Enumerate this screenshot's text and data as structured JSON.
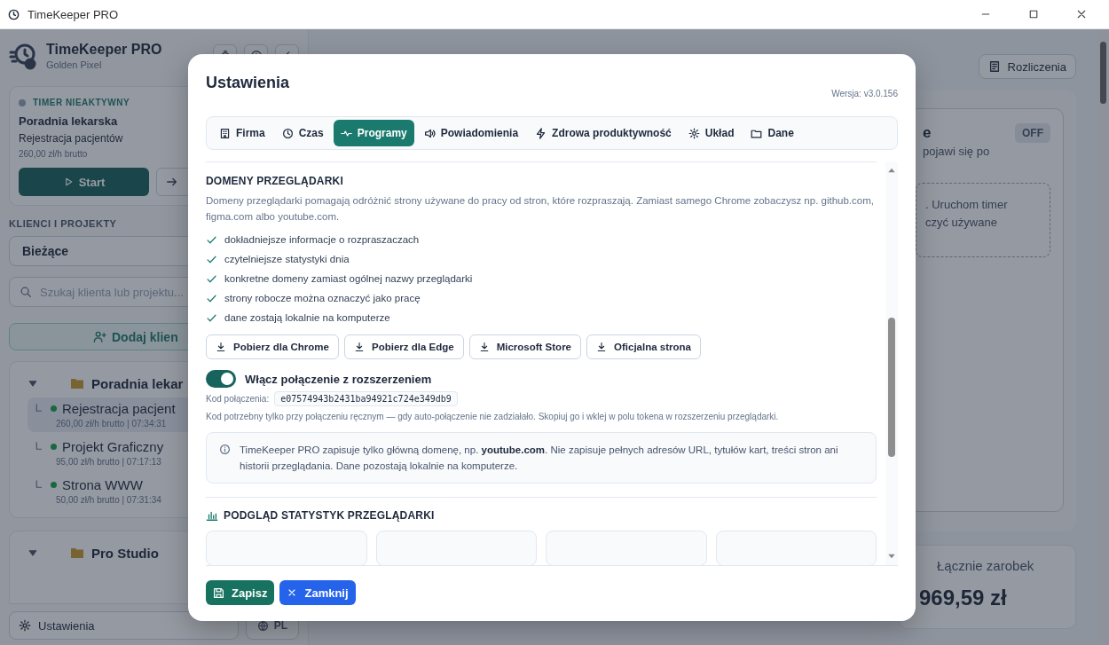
{
  "window": {
    "title": "TimeKeeper PRO"
  },
  "sidebar": {
    "app_name": "TimeKeeper PRO",
    "workspace": "Golden Pixel",
    "timer": {
      "status": "TIMER NIEAKTYWNY",
      "active": false,
      "client": "Poradnia lekarska",
      "project": "Rejestracja pacjentów",
      "rate": "260,00 zł/h brutto",
      "start_button": "Start"
    },
    "section_title": "KLIENCI I PROJEKTY",
    "filter": "Bieżące",
    "search": {
      "placeholder": "Szukaj klienta lub projektu..."
    },
    "add_button": "Dodaj klien",
    "clients": [
      {
        "name": "Poradnia lekar",
        "expanded": true,
        "projects": [
          {
            "name": "Rejestracja pacjent",
            "detail": "260,00 zł/h brutto | 07:34:31",
            "selected": true
          },
          {
            "name": "Projekt Graficzny",
            "detail": "95,00 zł/h brutto | 07:17:13",
            "selected": false
          },
          {
            "name": "Strona WWW",
            "detail": "50,00 zł/h brutto | 07:31:34",
            "selected": false
          }
        ]
      },
      {
        "name": "Pro Studio",
        "expanded": true
      }
    ],
    "settings_button": "Ustawienia",
    "language_button": "PL"
  },
  "main": {
    "billing_button": "Rozliczenia",
    "card": {
      "title": "e",
      "badge": "OFF",
      "subtitle": "pojawi się po",
      "empty_state": [
        ". Uruchom timer",
        "czyć używane"
      ]
    },
    "total": {
      "label": "Łącznie zarobek",
      "value": "969,59 zł"
    }
  },
  "modal": {
    "title": "Ustawienia",
    "version": "Wersja: v3.0.156",
    "tabs": [
      {
        "label": "Firma",
        "selected": false
      },
      {
        "label": "Czas",
        "selected": false
      },
      {
        "label": "Programy",
        "selected": true
      },
      {
        "label": "Powiadomienia",
        "selected": false
      },
      {
        "label": "Zdrowa produktywność",
        "selected": false
      },
      {
        "label": "Układ",
        "selected": false
      },
      {
        "label": "Dane",
        "selected": false
      }
    ],
    "section_title": "DOMENY PRZEGLĄDARKI",
    "description": "Domeny przeglądarki pomagają odróżnić strony używane do pracy od stron, które rozpraszają. Zamiast samego Chrome zobaczysz np. github.com, figma.com albo youtube.com.",
    "features": [
      "dokładniejsze informacje o rozpraszaczach",
      "czytelniejsze statystyki dnia",
      "konkretne domeny zamiast ogólnej nazwy przeglądarki",
      "strony robocze można oznaczyć jako pracę",
      "dane zostają lokalnie na komputerze"
    ],
    "downloads": [
      "Pobierz dla Chrome",
      "Pobierz dla Edge",
      "Microsoft Store",
      "Oficjalna strona"
    ],
    "extension": {
      "label": "Włącz połączenie z rozszerzeniem",
      "on": true
    },
    "code_label": "Kod połączenia:",
    "code": "e07574943b2431ba94921c724e349db9",
    "note": "Kod potrzebny tylko przy połączeniu ręcznym — gdy auto-połączenie nie zadziałało. Skopiuj go i wklej w polu tokena w rozszerzeniu przeglądarki.",
    "info": "TimeKeeper PRO zapisuje tylko główną domenę, np. **youtube.com**. Nie zapisuje pełnych adresów URL, tytułów kart, treści stron ani historii przeglądania. Dane pozostają lokalnie na komputerze.",
    "stats_title": "PODGLĄD STATYSTYK PRZEGLĄDARKI",
    "save_button": "Zapisz",
    "close_button": "Zamknij"
  }
}
